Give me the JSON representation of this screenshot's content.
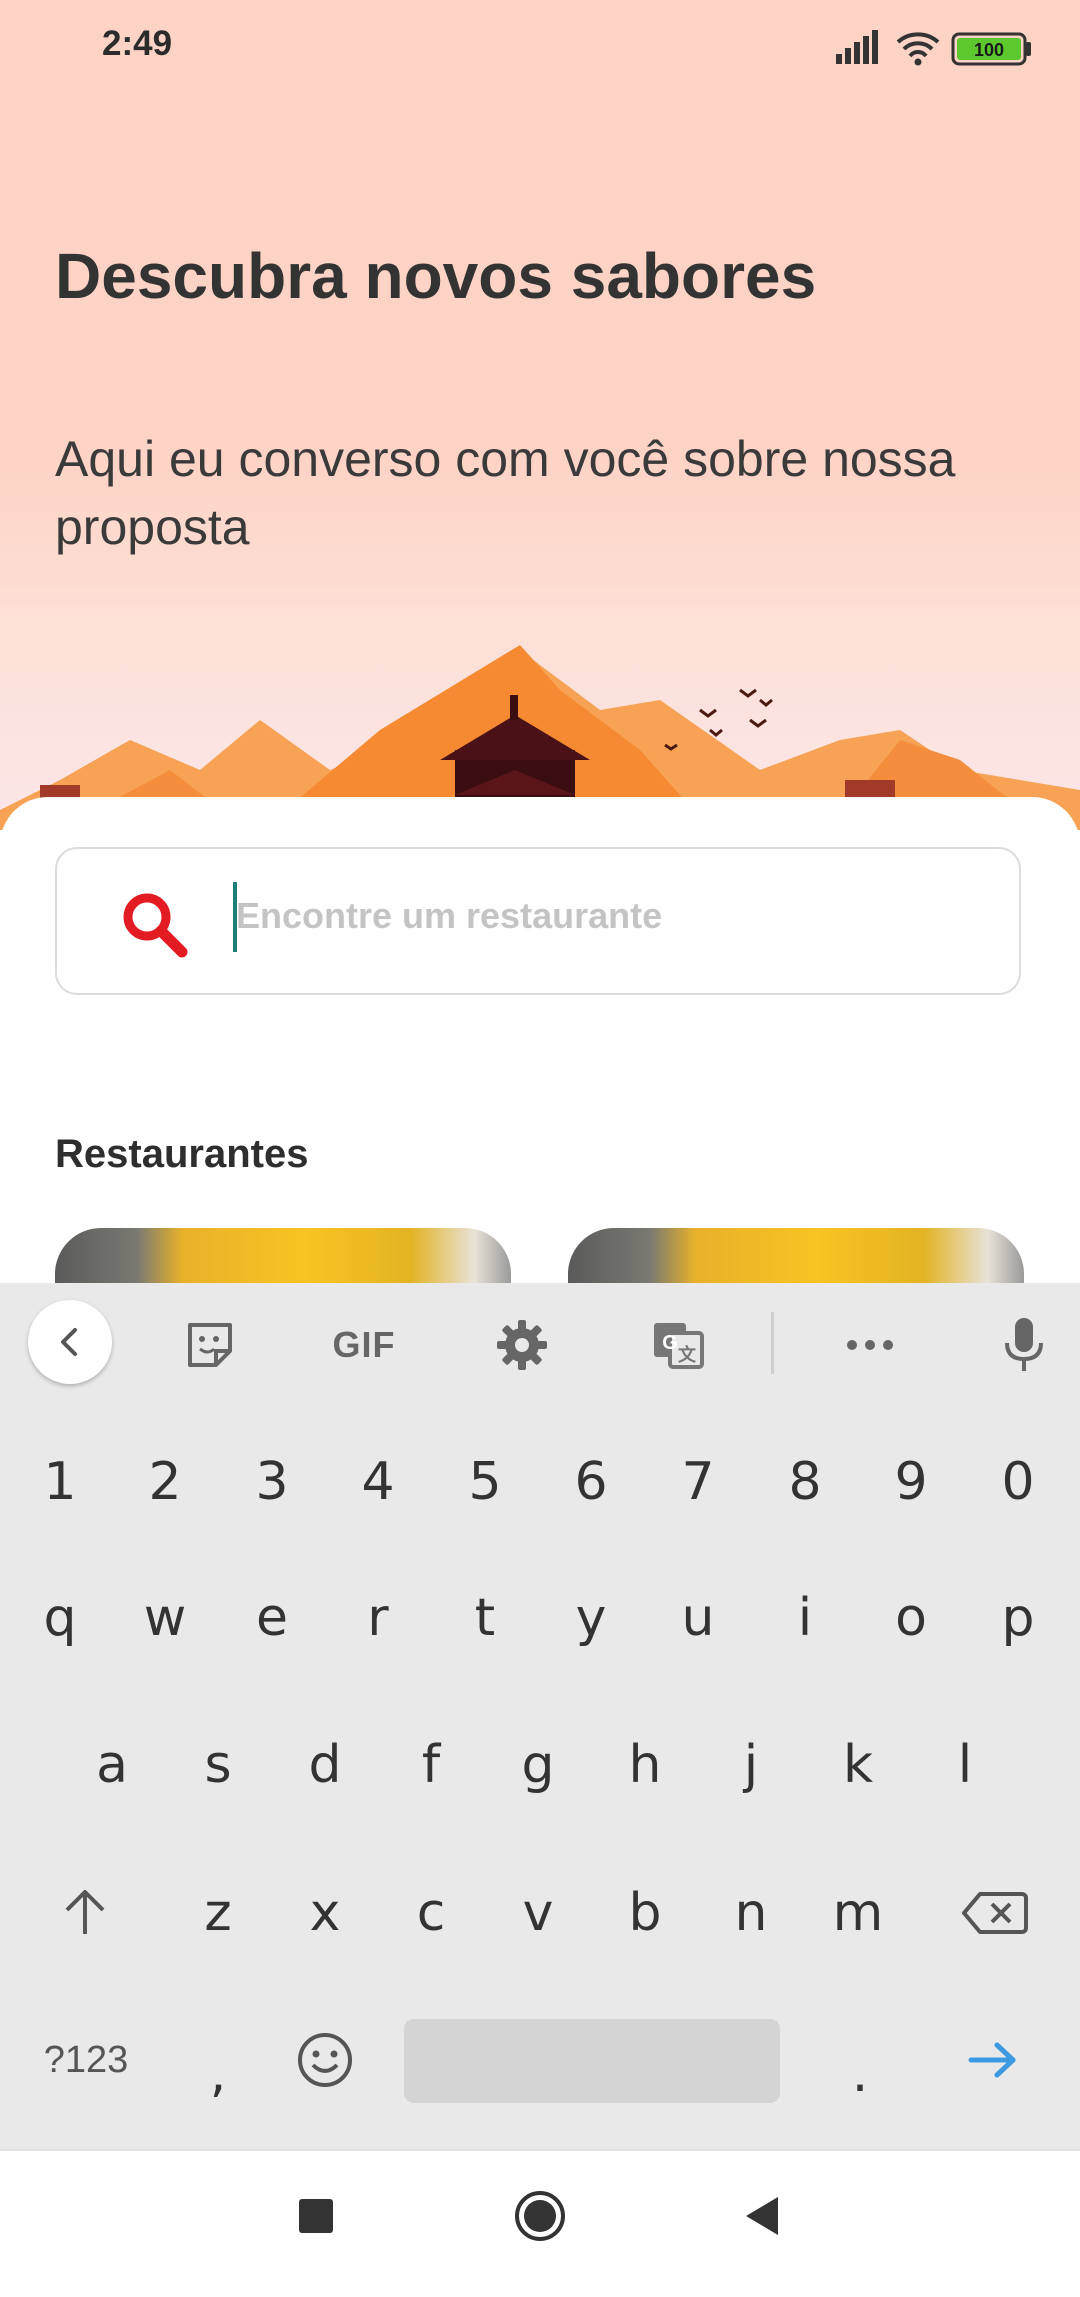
{
  "status_bar": {
    "time": "2:49",
    "battery": "100"
  },
  "hero": {
    "title": "Descubra novos sabores",
    "subtitle": "Aqui eu converso com você sobre nossa proposta"
  },
  "search": {
    "placeholder": "Encontre um restaurante",
    "value": ""
  },
  "restaurants": {
    "heading": "Restaurantes"
  },
  "keyboard": {
    "toolbar": {
      "gif_label": "GIF",
      "icons": [
        "chevron-left-icon",
        "sticker-icon",
        "gif-icon",
        "gear-icon",
        "translate-icon",
        "more-icon",
        "mic-icon"
      ]
    },
    "number_row": [
      "1",
      "2",
      "3",
      "4",
      "5",
      "6",
      "7",
      "8",
      "9",
      "0"
    ],
    "row1": [
      "q",
      "w",
      "e",
      "r",
      "t",
      "y",
      "u",
      "i",
      "o",
      "p"
    ],
    "row2": [
      "a",
      "s",
      "d",
      "f",
      "g",
      "h",
      "j",
      "k",
      "l"
    ],
    "row3": [
      "z",
      "x",
      "c",
      "v",
      "b",
      "n",
      "m"
    ],
    "bottom": {
      "symbols": "?123",
      "comma": ",",
      "period": "."
    },
    "accent_color": "#3b9ae1"
  },
  "navigation": {
    "icons": [
      "recent-apps-icon",
      "home-icon",
      "back-icon"
    ]
  },
  "colors": {
    "hero_bg": "#fdd3c5",
    "search_icon": "#e31b23",
    "cursor": "#1d7f73"
  }
}
